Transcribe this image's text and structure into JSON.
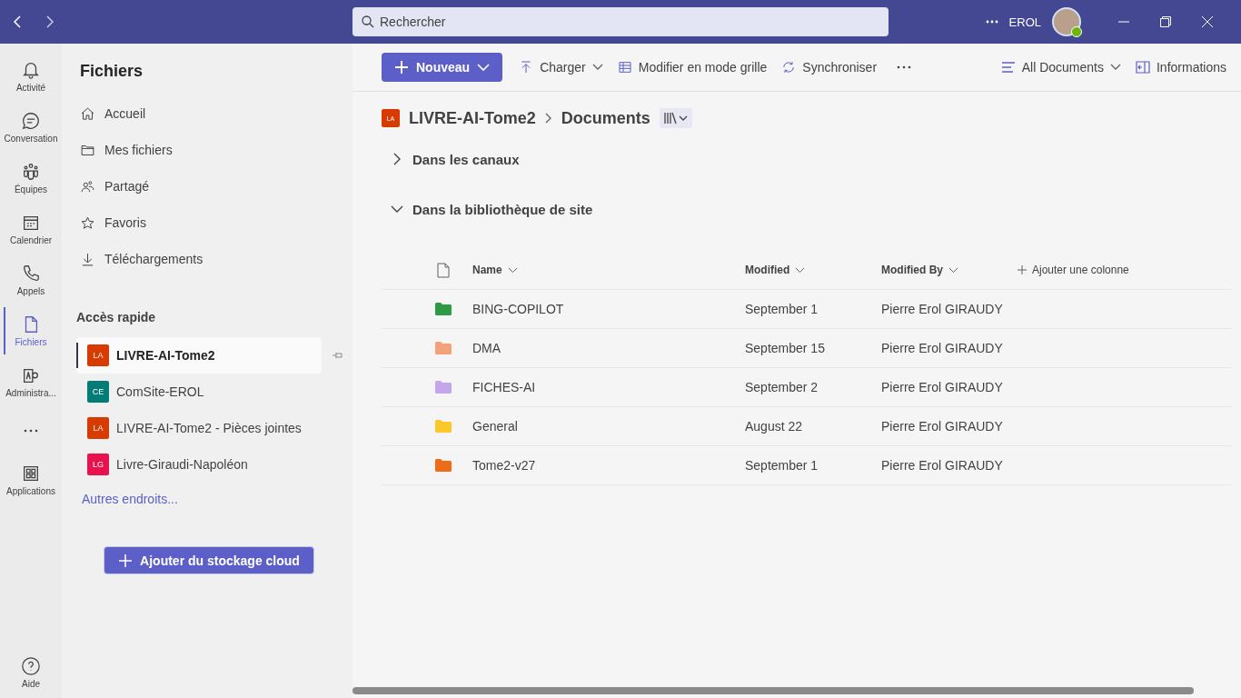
{
  "search": {
    "placeholder": "Rechercher"
  },
  "header": {
    "user": "EROL"
  },
  "rail": {
    "items": [
      {
        "kind": "bell",
        "label": "Activité",
        "selected": false
      },
      {
        "kind": "chat",
        "label": "Conversation",
        "selected": false
      },
      {
        "kind": "teams",
        "label": "Équipes",
        "selected": false
      },
      {
        "kind": "calendar",
        "label": "Calendrier",
        "selected": false
      },
      {
        "kind": "phone",
        "label": "Appels",
        "selected": false
      },
      {
        "kind": "file",
        "label": "Fichiers",
        "selected": true
      },
      {
        "kind": "admin",
        "label": "Administra...",
        "selected": false
      },
      {
        "kind": "more",
        "selected": false
      },
      {
        "kind": "apps",
        "label": "Applications",
        "selected": false
      }
    ],
    "help": "Aide"
  },
  "sidebar": {
    "title": "Fichiers",
    "nav": [
      {
        "kind": "home",
        "label": "Accueil"
      },
      {
        "kind": "folder",
        "label": "Mes fichiers"
      },
      {
        "kind": "shared",
        "label": "Partagé"
      },
      {
        "kind": "star",
        "label": "Favoris"
      },
      {
        "kind": "download",
        "label": "Téléchargements"
      }
    ],
    "quick_access_title": "Accès rapide",
    "quick_access": [
      {
        "initials": "LA",
        "label": "LIVRE-AI-Tome2",
        "color": "#d83b01",
        "selected": true
      },
      {
        "initials": "CE",
        "label": "ComSite-EROL",
        "color": "#037c76",
        "selected": false
      },
      {
        "initials": "LA",
        "label": "LIVRE-AI-Tome2 - Pièces jointes",
        "color": "#d83b01",
        "selected": false
      },
      {
        "initials": "LG",
        "label": "Livre-Giraudi-Napoléon",
        "color": "#e8124f",
        "selected": false
      }
    ],
    "more_link": "Autres endroits...",
    "add_cloud_button": "Ajouter du stockage cloud"
  },
  "toolbar": {
    "new_button": "Nouveau",
    "actions": [
      {
        "kind": "upload",
        "label": "Charger",
        "dropdown": true
      },
      {
        "kind": "grid",
        "label": "Modifier en mode grille",
        "dropdown": false
      },
      {
        "kind": "sync",
        "label": "Synchroniser",
        "dropdown": false
      }
    ],
    "view": "All Documents",
    "info": "Informations"
  },
  "breadcrumb": {
    "initials": "LA",
    "site": "LIVRE-AI-Tome2",
    "library": "Documents"
  },
  "sections": [
    {
      "label": "Dans les canaux",
      "expanded": false
    },
    {
      "label": "Dans la bibliothèque de site",
      "expanded": true
    }
  ],
  "table": {
    "columns": [
      "Name",
      "Modified",
      "Modified By"
    ],
    "add_column": "Ajouter une colonne",
    "rows": [
      {
        "name": "BING-COPILOT",
        "modified": "September 1",
        "modified_by": "Pierre Erol GIRAUDY",
        "color": "#2e9a45"
      },
      {
        "name": "DMA",
        "modified": "September 15",
        "modified_by": "Pierre Erol GIRAUDY",
        "color": "#f4a07a"
      },
      {
        "name": "FICHES-AI",
        "modified": "September 2",
        "modified_by": "Pierre Erol GIRAUDY",
        "color": "#c5a5ec"
      },
      {
        "name": "General",
        "modified": "August 22",
        "modified_by": "Pierre Erol GIRAUDY",
        "color": "#fbc82c"
      },
      {
        "name": "Tome2-v27",
        "modified": "September 1",
        "modified_by": "Pierre Erol GIRAUDY",
        "color": "#ef6c16"
      }
    ]
  }
}
